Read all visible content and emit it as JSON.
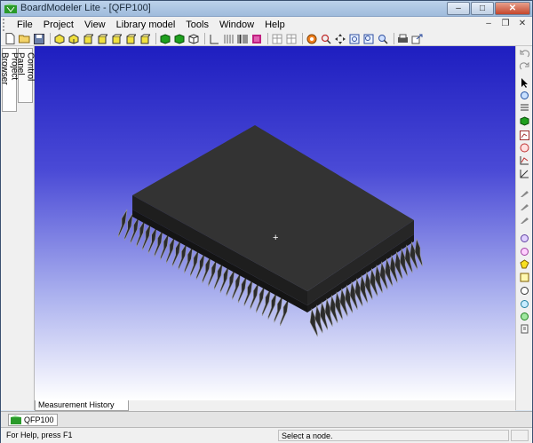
{
  "window": {
    "title": "BoardModeler Lite - [QFP100]",
    "minimize_glyph": "–",
    "maximize_glyph": "□",
    "close_glyph": "✕"
  },
  "menubar": {
    "items": [
      "File",
      "Project",
      "View",
      "Library model",
      "Tools",
      "Window",
      "Help"
    ],
    "mdi_minimize": "–",
    "mdi_restore": "❐",
    "mdi_close": "✕"
  },
  "toolbar": {
    "icons": [
      "new-file-icon",
      "open-folder-icon",
      "save-icon",
      "separator",
      "view-top-icon",
      "view-bottom-icon",
      "view-front-icon",
      "view-back-icon",
      "view-left-icon",
      "view-right-icon",
      "view-iso-icon",
      "separator",
      "shade-solid-icon",
      "shade-green-icon",
      "wireframe-icon",
      "separator",
      "axis-icon",
      "grid-lines-icon",
      "barcode-icon",
      "color-map-icon",
      "separator",
      "table-icon",
      "table2-icon",
      "separator",
      "measure-icon",
      "find-icon",
      "move-icon",
      "zoom-fit-icon",
      "zoom-window-icon",
      "zoom-icon",
      "separator",
      "print-icon",
      "export-icon"
    ]
  },
  "left_panel": {
    "tabs": [
      "Control Panel",
      "Project Browser"
    ]
  },
  "viewport": {
    "crosshair": "+"
  },
  "right_toolbar": {
    "icons": [
      "undo-icon",
      "redo-icon",
      "select-arrow-icon",
      "rotate-icon",
      "section-icon",
      "view-cube-icon",
      "chart-icon",
      "layers-icon",
      "graph-icon",
      "probe-icon",
      "probe2-icon",
      "probe3-icon",
      "attach-icon",
      "tag-icon",
      "highlight-icon",
      "note-icon",
      "rotate-part-icon",
      "refresh-icon",
      "clipboard-icon"
    ]
  },
  "measurement_panel": {
    "tab_label": "Measurement History Panel"
  },
  "document_tabs": {
    "items": [
      "QFP100"
    ]
  },
  "statusbar": {
    "help_text": "For Help, press F1",
    "message": "Select a node."
  },
  "colors": {
    "viewport_top": "#1e1ec0",
    "viewport_bottom": "#ffffff",
    "package_body": "#2a2a2a",
    "accent_green": "#1fa01f"
  }
}
